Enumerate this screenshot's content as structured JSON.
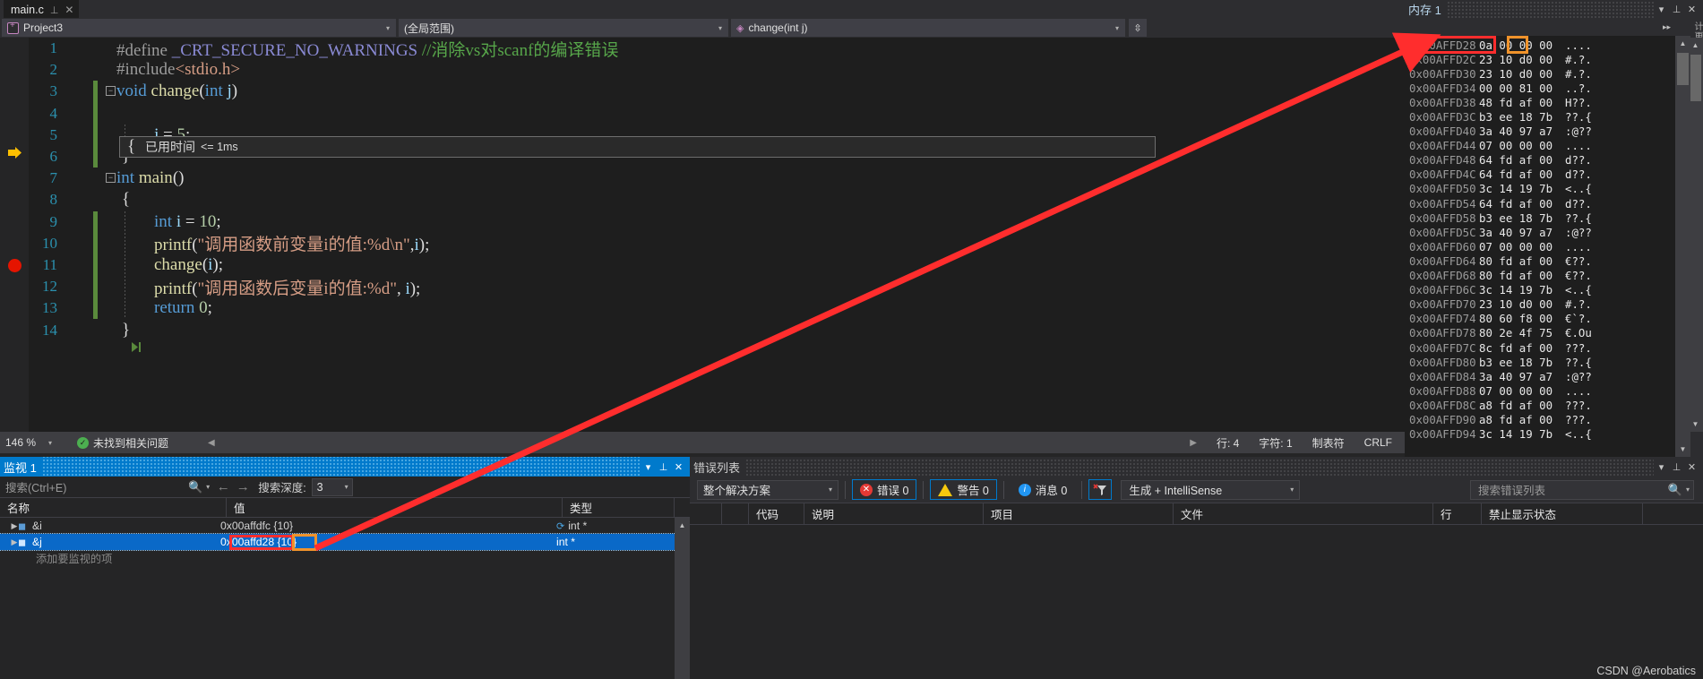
{
  "window": {
    "document_tab": "main.c",
    "memory_window_title": "内存 1",
    "vertical_tabs": "计更改"
  },
  "navbar": {
    "project": "Project3",
    "scope": "(全局范围)",
    "member": "change(int j)"
  },
  "editor": {
    "lines": [
      {
        "n": "1",
        "text": "#define _CRT_SECURE_NO_WARNINGS //消除vs对scanf的编译错误"
      },
      {
        "n": "2",
        "text": "#include<stdio.h>"
      },
      {
        "n": "3",
        "text": "void change(int j)"
      },
      {
        "n": "4",
        "text": "{"
      },
      {
        "n": "5",
        "text": "    j = 5;"
      },
      {
        "n": "6",
        "text": "}"
      },
      {
        "n": "7",
        "text": "int main()"
      },
      {
        "n": "8",
        "text": "{"
      },
      {
        "n": "9",
        "text": "    int i = 10;"
      },
      {
        "n": "10",
        "text": "    printf(\"调用函数前变量i的值:%d\\n\",i);"
      },
      {
        "n": "11",
        "text": "    change(i);"
      },
      {
        "n": "12",
        "text": "    printf(\"调用函数后变量i的值:%d\", i);"
      },
      {
        "n": "13",
        "text": "    return 0;"
      },
      {
        "n": "14",
        "text": "}"
      }
    ],
    "elapsed_tip_label": "已用时间",
    "elapsed_tip_value": "<= 1ms"
  },
  "editor_status": {
    "zoom": "146 %",
    "problems": "未找到相关问题",
    "line_label": "行: 4",
    "char_label": "字符: 1",
    "tabs_label": "制表符",
    "eol_label": "CRLF"
  },
  "memory": {
    "rows": [
      {
        "addr": "0x00AFFD28",
        "bytes": "0a 00 00 00",
        "ascii": "...."
      },
      {
        "addr": "0x00AFFD2C",
        "bytes": "23 10 d0 00",
        "ascii": "#.?."
      },
      {
        "addr": "0x00AFFD30",
        "bytes": "23 10 d0 00",
        "ascii": "#.?."
      },
      {
        "addr": "0x00AFFD34",
        "bytes": "00 00 81 00",
        "ascii": "..?."
      },
      {
        "addr": "0x00AFFD38",
        "bytes": "48 fd af 00",
        "ascii": "H??."
      },
      {
        "addr": "0x00AFFD3C",
        "bytes": "b3 ee 18 7b",
        "ascii": "??.{"
      },
      {
        "addr": "0x00AFFD40",
        "bytes": "3a 40 97 a7",
        "ascii": ":@??"
      },
      {
        "addr": "0x00AFFD44",
        "bytes": "07 00 00 00",
        "ascii": "...."
      },
      {
        "addr": "0x00AFFD48",
        "bytes": "64 fd af 00",
        "ascii": "d??."
      },
      {
        "addr": "0x00AFFD4C",
        "bytes": "64 fd af 00",
        "ascii": "d??."
      },
      {
        "addr": "0x00AFFD50",
        "bytes": "3c 14 19 7b",
        "ascii": "<..{"
      },
      {
        "addr": "0x00AFFD54",
        "bytes": "64 fd af 00",
        "ascii": "d??."
      },
      {
        "addr": "0x00AFFD58",
        "bytes": "b3 ee 18 7b",
        "ascii": "??.{"
      },
      {
        "addr": "0x00AFFD5C",
        "bytes": "3a 40 97 a7",
        "ascii": ":@??"
      },
      {
        "addr": "0x00AFFD60",
        "bytes": "07 00 00 00",
        "ascii": "...."
      },
      {
        "addr": "0x00AFFD64",
        "bytes": "80 fd af 00",
        "ascii": "€??."
      },
      {
        "addr": "0x00AFFD68",
        "bytes": "80 fd af 00",
        "ascii": "€??."
      },
      {
        "addr": "0x00AFFD6C",
        "bytes": "3c 14 19 7b",
        "ascii": "<..{"
      },
      {
        "addr": "0x00AFFD70",
        "bytes": "23 10 d0 00",
        "ascii": "#.?."
      },
      {
        "addr": "0x00AFFD74",
        "bytes": "80 60 f8 00",
        "ascii": "€`?."
      },
      {
        "addr": "0x00AFFD78",
        "bytes": "80 2e 4f 75",
        "ascii": "€.Ou"
      },
      {
        "addr": "0x00AFFD7C",
        "bytes": "8c fd af 00",
        "ascii": "???."
      },
      {
        "addr": "0x00AFFD80",
        "bytes": "b3 ee 18 7b",
        "ascii": "??.{"
      },
      {
        "addr": "0x00AFFD84",
        "bytes": "3a 40 97 a7",
        "ascii": ":@??"
      },
      {
        "addr": "0x00AFFD88",
        "bytes": "07 00 00 00",
        "ascii": "...."
      },
      {
        "addr": "0x00AFFD8C",
        "bytes": "a8 fd af 00",
        "ascii": "???."
      },
      {
        "addr": "0x00AFFD90",
        "bytes": "a8 fd af 00",
        "ascii": "???."
      },
      {
        "addr": "0x00AFFD94",
        "bytes": "3c 14 19 7b",
        "ascii": "<..{"
      }
    ]
  },
  "watch": {
    "title": "监视 1",
    "search_placeholder": "搜索(Ctrl+E)",
    "depth_label": "搜索深度:",
    "depth_value": "3",
    "columns": [
      "名称",
      "值",
      "类型"
    ],
    "rows": [
      {
        "name": "&i",
        "value": "0x00affdfc {10}",
        "type": "int *",
        "selected": false
      },
      {
        "name": "&j",
        "value": "0x00affd28 {10}",
        "type": "int *",
        "selected": true
      }
    ],
    "add_item": "添加要监视的项"
  },
  "error_list": {
    "title": "错误列表",
    "scope": "整个解决方案",
    "errors": "错误 0",
    "warnings": "警告 0",
    "messages": "消息 0",
    "build_filter": "生成 + IntelliSense",
    "search_placeholder": "搜索错误列表",
    "columns": [
      "",
      "",
      "代码",
      "说明",
      "项目",
      "文件",
      "行",
      "禁止显示状态"
    ]
  },
  "watermark": "CSDN @Aerobatics",
  "colors": {
    "accent": "#007acc",
    "annotation_red": "#ff2d2d",
    "annotation_orange": "#f0932b",
    "selection_blue": "#0a69c8"
  }
}
